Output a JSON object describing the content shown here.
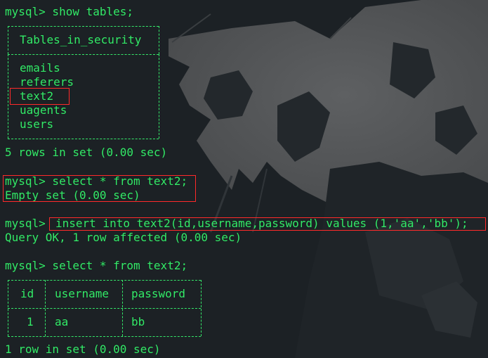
{
  "colors": {
    "text": "#35e86a",
    "highlight": "#ff2a2a",
    "background": "#1c2125",
    "wallpaper_light": "#5b5d5e"
  },
  "session": {
    "cmd1": "mysql> show tables;",
    "table1": {
      "header": "Tables_in_security",
      "rows": [
        "emails",
        "referers",
        "text2",
        "uagents",
        "users"
      ]
    },
    "result1": "5 rows in set (0.00 sec)",
    "cmd2": "mysql> select * from text2;",
    "result2": "Empty set (0.00 sec)",
    "prompt3": "mysql>",
    "cmd3": "insert into text2(id,username,password) values (1,'aa','bb');",
    "result3": "Query OK, 1 row affected (0.00 sec)",
    "cmd4": "mysql> select * from text2;",
    "table2": {
      "headers": [
        "id",
        "username",
        "password"
      ],
      "rows": [
        [
          "1",
          "aa",
          "bb"
        ]
      ]
    },
    "result4": "1 row in set (0.00 sec)"
  }
}
